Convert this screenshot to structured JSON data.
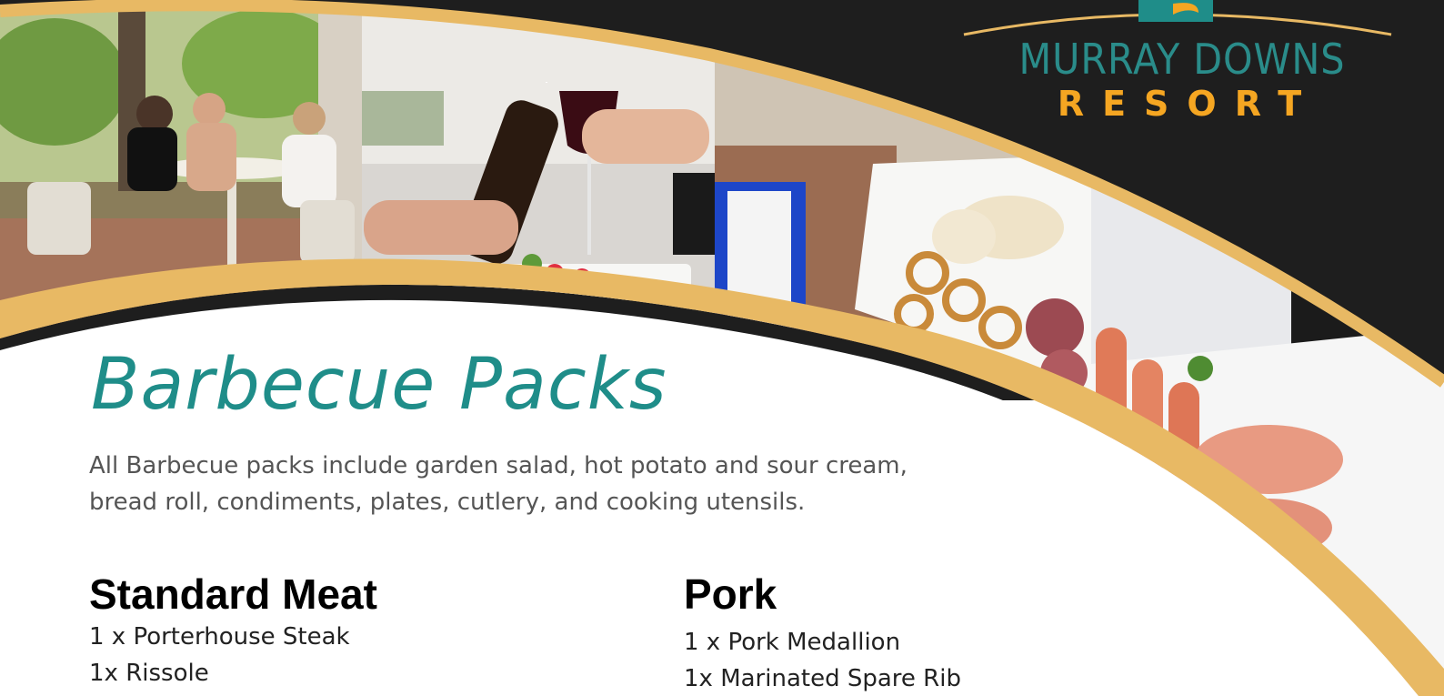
{
  "brand": {
    "name_line1": "MURRAY DOWNS",
    "name_line2": "RESORT",
    "colors": {
      "teal": "#1f8d89",
      "gold": "#e8b964",
      "dark": "#1e1e1e",
      "orange": "#f5a622"
    }
  },
  "photos": [
    {
      "name": "dining-photo"
    },
    {
      "name": "toast-photo"
    },
    {
      "name": "platter-photo"
    },
    {
      "name": "sausages-photo"
    }
  ],
  "title": "Barbecue Packs",
  "intro": {
    "line1": "All Barbecue packs include garden salad, hot potato and sour cream,",
    "line2": "bread roll, condiments, plates, cutlery, and cooking utensils."
  },
  "packs": [
    {
      "title": "Standard Meat",
      "items": [
        "1 x Porterhouse Steak",
        "1x Rissole"
      ]
    },
    {
      "title": "Pork",
      "items": [
        "1 x Pork Medallion",
        "1x Marinated Spare Rib"
      ]
    }
  ]
}
